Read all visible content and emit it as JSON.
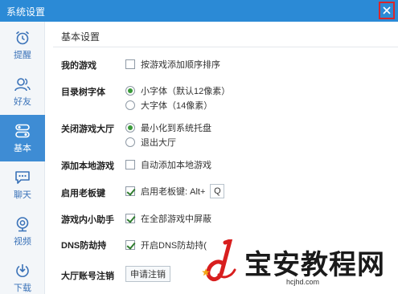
{
  "window": {
    "title": "系统设置"
  },
  "sidebar": {
    "items": [
      {
        "label": "提醒",
        "icon": "alarm-clock-icon"
      },
      {
        "label": "好友",
        "icon": "friends-icon"
      },
      {
        "label": "基本",
        "icon": "toggle-settings-icon",
        "active": true
      },
      {
        "label": "聊天",
        "icon": "chat-icon"
      },
      {
        "label": "视频",
        "icon": "webcam-icon"
      },
      {
        "label": "下载",
        "icon": "download-icon"
      }
    ]
  },
  "section": {
    "title": "基本设置"
  },
  "settings": {
    "my_games": {
      "label": "我的游戏",
      "option": "按游戏添加顺序排序",
      "checked": false
    },
    "tree_font": {
      "label": "目录树字体",
      "options": [
        {
          "text": "小字体（默认12像素）",
          "selected": true
        },
        {
          "text": "大字体（14像素）",
          "selected": false
        }
      ]
    },
    "close_hall": {
      "label": "关闭游戏大厅",
      "options": [
        {
          "text": "最小化到系统托盘",
          "selected": true
        },
        {
          "text": "退出大厅",
          "selected": false
        }
      ]
    },
    "add_local": {
      "label": "添加本地游戏",
      "option": "自动添加本地游戏",
      "checked": false
    },
    "boss_key": {
      "label": "启用老板键",
      "option": "启用老板键: Alt+",
      "key": "Q",
      "checked": true
    },
    "assistant": {
      "label": "游戏内小助手",
      "option": "在全部游戏中屏蔽",
      "checked": true
    },
    "dns": {
      "label": "DNS防劫持",
      "option": "开启DNS防劫持(",
      "checked": true
    },
    "account": {
      "label": "大厅账号注销",
      "button": "申请注销"
    }
  },
  "watermark": {
    "text": "宝安教程网",
    "url": "hcjhd.com"
  },
  "colors": {
    "titlebar": "#2b8ad6",
    "accent": "#3e8cd4",
    "close_highlight": "#d8262a",
    "watermark_red": "#d81e1e",
    "watermark_star": "#f2a515"
  }
}
